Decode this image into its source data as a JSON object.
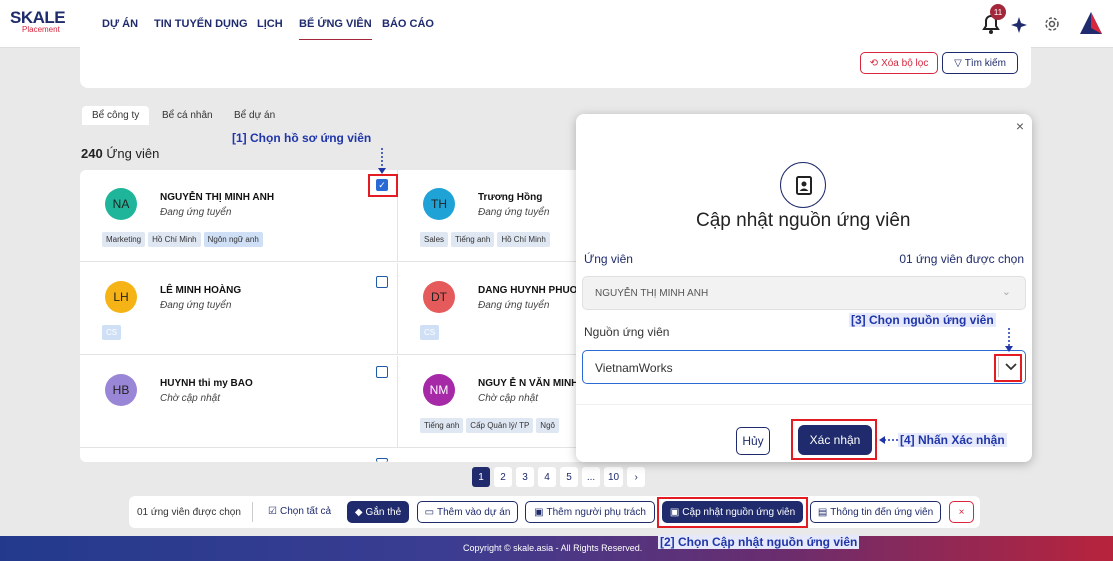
{
  "app": {
    "logo_main": "SKALE",
    "logo_sub": "Placement",
    "nav": [
      "DỰ ÁN",
      "TIN TUYỂN DỤNG",
      "LỊCH",
      "BỂ ỨNG VIÊN",
      "BÁO CÁO"
    ],
    "notification_count": "11"
  },
  "filters": {
    "clear_label": "Xóa bộ lọc",
    "search_label": "Tìm kiếm"
  },
  "tabs": [
    "Bể công ty",
    "Bể cá nhân",
    "Bể dự án"
  ],
  "count": {
    "number": "240",
    "label": "Ứng viên"
  },
  "candidates": [
    {
      "initials": "NA",
      "name": "NGUYỄN THỊ MINH ANH",
      "status": "Đang ứng tuyển",
      "tags": [
        "Marketing",
        "Hồ Chí Minh",
        "Ngôn ngữ anh"
      ],
      "color": "#1fb59a",
      "checked": true
    },
    {
      "initials": "TH",
      "name": "Trương Hồng",
      "status": "Đang ứng tuyển",
      "tags": [
        "Sales",
        "Tiếng anh",
        "Hồ Chí Minh"
      ],
      "color": "#1fa3d6",
      "checked": false
    },
    {
      "initials": "LH",
      "name": "LÊ MINH HOÀNG",
      "status": "Đang ứng tuyển",
      "tags": [
        "CS"
      ],
      "color": "#f5b316",
      "checked": false
    },
    {
      "initials": "DT",
      "name": "DANG HUYNH PHUOM",
      "status": "Đang ứng tuyển",
      "tags": [
        "CS"
      ],
      "color": "#e55b5b",
      "checked": false
    },
    {
      "initials": "HB",
      "name": "HUYNH thi my BAO",
      "status": "Chờ cập nhật",
      "tags": [],
      "color": "#9a86d6",
      "checked": false
    },
    {
      "initials": "NM",
      "name": "NGUY Ễ N VĂN MINH",
      "status": "Chờ cập nhật",
      "tags": [
        "Tiếng anh",
        "Cấp Quản lý/ TP",
        "Ngô"
      ],
      "color": "#a629a8",
      "checked": false
    }
  ],
  "pagination": [
    "1",
    "2",
    "3",
    "4",
    "5",
    "...",
    "10",
    "›"
  ],
  "actionbar": {
    "selected_text": "01 ứng viên được chọn",
    "select_all": "Chọn tất cả",
    "tag": "Gắn thẻ",
    "add_project": "Thêm vào dự án",
    "add_owner": "Thêm người phụ trách",
    "update_source": "Cập nhật nguồn ứng viên",
    "info": "Thông tin đến ứng viên",
    "close": "×"
  },
  "footer": "Copyright © skale.asia - All Rights Reserved.",
  "modal": {
    "close": "×",
    "title": "Cập nhật nguồn ứng viên",
    "candidate_label": "Ứng viên",
    "candidate_count": "01 ứng viên được chọn",
    "candidate_value": "NGUYỄN THỊ MINH ANH",
    "source_label": "Nguồn ứng viên",
    "source_value": "VietnamWorks",
    "cancel": "Hủy",
    "confirm": "Xác nhận"
  },
  "annotations": {
    "step1": "[1] Chọn hồ sơ ứng viên",
    "step2": "[2] Chọn Cập nhật nguồn ứng viên",
    "step3": "[3] Chọn nguồn ứng viên",
    "step4": "[4] Nhấn Xác nhận"
  },
  "colors": {
    "navy": "#1f2b6c",
    "red": "#d7263d",
    "highlight": "#e31b23",
    "annotation": "#2036a8"
  }
}
